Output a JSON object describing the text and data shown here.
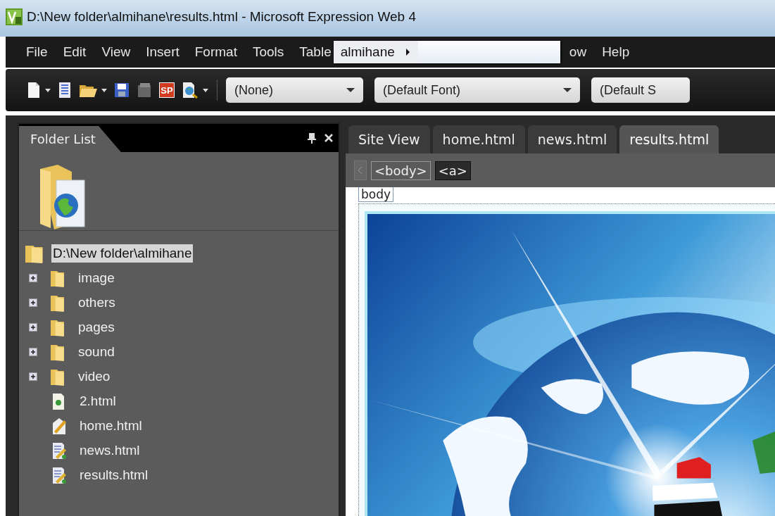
{
  "window": {
    "title": "D:\\New folder\\almihane\\results.html - Microsoft Expression Web 4"
  },
  "menu": [
    {
      "label": "File"
    },
    {
      "label": "Edit"
    },
    {
      "label": "View"
    },
    {
      "label": "Insert"
    },
    {
      "label": "Format"
    },
    {
      "label": "Tools"
    },
    {
      "label": "Table"
    }
  ],
  "popup": {
    "label": "almihane"
  },
  "menu_after_popup": [
    {
      "label": "ow"
    },
    {
      "label": "Help"
    }
  ],
  "toolbar": {
    "sp_label": "SP",
    "dropdowns": [
      {
        "value": "(None)"
      },
      {
        "value": "(Default Font)"
      },
      {
        "value": "(Default S"
      }
    ]
  },
  "folder_list": {
    "title": "Folder List",
    "root": {
      "label": "D:\\New folder\\almihane",
      "selected": true,
      "children": [
        {
          "label": "image",
          "kind": "folder",
          "expanded": false,
          "selected": false
        },
        {
          "label": "others",
          "kind": "folder",
          "expanded": false,
          "selected": false
        },
        {
          "label": "pages",
          "kind": "folder",
          "expanded": false,
          "selected": false
        },
        {
          "label": "sound",
          "kind": "folder",
          "expanded": false,
          "selected": false
        },
        {
          "label": "video",
          "kind": "folder",
          "expanded": false,
          "selected": false
        },
        {
          "label": "2.html",
          "kind": "page",
          "selected": false
        },
        {
          "label": "home.html",
          "kind": "home",
          "selected": false
        },
        {
          "label": "news.html",
          "kind": "edited",
          "selected": false
        },
        {
          "label": "results.html",
          "kind": "edited",
          "selected": false
        }
      ]
    }
  },
  "editor": {
    "tabs": [
      {
        "label": "Site View",
        "selected": false
      },
      {
        "label": "home.html",
        "selected": false
      },
      {
        "label": "news.html",
        "selected": false
      },
      {
        "label": "results.html",
        "selected": true
      }
    ],
    "tag_path": [
      {
        "label": "<body>",
        "selected": false
      },
      {
        "label": "<a>",
        "selected": true
      }
    ],
    "body_label": "body"
  }
}
